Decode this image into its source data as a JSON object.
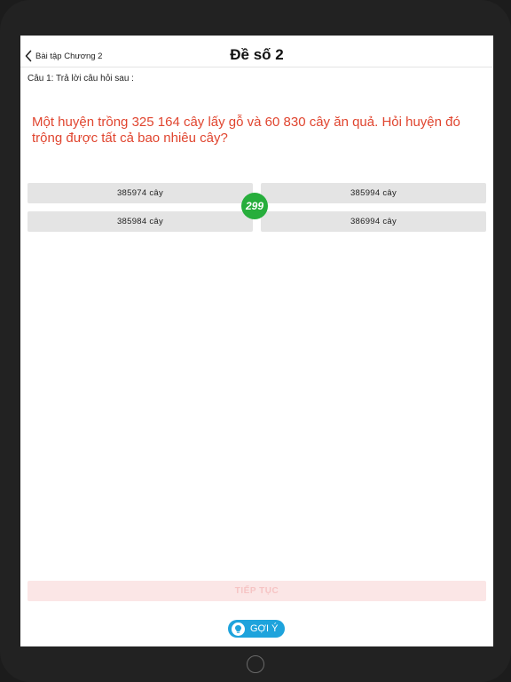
{
  "nav": {
    "back_label": "Bài tập Chương 2",
    "title": "Đề số 2"
  },
  "question": {
    "label": "Câu 1: Trả lời câu hỏi sau :",
    "text": "Một huyện trồng 325 164 cây lấy gỗ và 60 830 cây ăn quả. Hỏi huyện đó trộng được tất cả bao nhiêu cây?"
  },
  "answers": [
    "385974 cây",
    "385994 cây",
    "385984 cây",
    "386994 cây"
  ],
  "timer": "299",
  "continue_label": "TIẾP TỤC",
  "hint_label": "GỢI Ý",
  "icons": {
    "back": "chevron-left-icon",
    "hint": "lightbulb-icon"
  },
  "colors": {
    "question_text": "#e0452f",
    "timer_bg": "#27ae3c",
    "hint_bg": "#1ea3dc",
    "continue_bg": "#fbe6e6"
  }
}
